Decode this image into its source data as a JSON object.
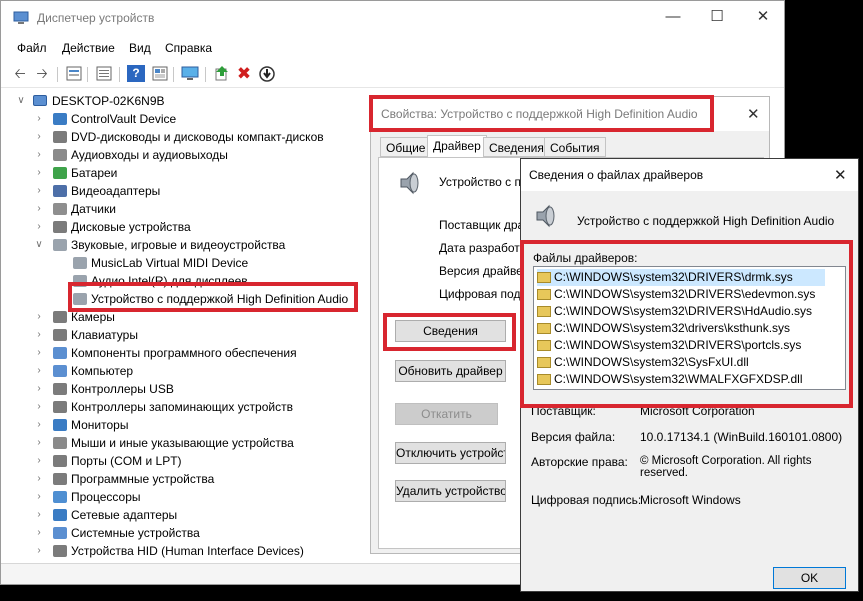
{
  "main_window": {
    "title": "Диспетчер устройств",
    "menu": [
      "Файл",
      "Действие",
      "Вид",
      "Справка"
    ],
    "tree": {
      "root": "DESKTOP-02K6N9B",
      "items": [
        {
          "label": "ControlVault Device",
          "level": 1,
          "expanded": false
        },
        {
          "label": "DVD-дисководы и дисководы компакт-дисков",
          "level": 1,
          "expanded": false
        },
        {
          "label": "Аудиовходы и аудиовыходы",
          "level": 1,
          "expanded": false
        },
        {
          "label": "Батареи",
          "level": 1,
          "expanded": false
        },
        {
          "label": "Видеоадаптеры",
          "level": 1,
          "expanded": false
        },
        {
          "label": "Датчики",
          "level": 1,
          "expanded": false
        },
        {
          "label": "Дисковые устройства",
          "level": 1,
          "expanded": false
        },
        {
          "label": "Звуковые, игровые и видеоустройства",
          "level": 1,
          "expanded": true
        },
        {
          "label": "MusicLab Virtual MIDI Device",
          "level": 2
        },
        {
          "label": "Аудио Intel(R) для дисплеев",
          "level": 2
        },
        {
          "label": "Устройство с поддержкой High Definition Audio",
          "level": 2,
          "highlighted": true
        },
        {
          "label": "Камеры",
          "level": 1,
          "expanded": false
        },
        {
          "label": "Клавиатуры",
          "level": 1,
          "expanded": false
        },
        {
          "label": "Компоненты программного обеспечения",
          "level": 1,
          "expanded": false
        },
        {
          "label": "Компьютер",
          "level": 1,
          "expanded": false
        },
        {
          "label": "Контроллеры USB",
          "level": 1,
          "expanded": false
        },
        {
          "label": "Контроллеры запоминающих устройств",
          "level": 1,
          "expanded": false
        },
        {
          "label": "Мониторы",
          "level": 1,
          "expanded": false
        },
        {
          "label": "Мыши и иные указывающие устройства",
          "level": 1,
          "expanded": false
        },
        {
          "label": "Порты (COM и LPT)",
          "level": 1,
          "expanded": false
        },
        {
          "label": "Программные устройства",
          "level": 1,
          "expanded": false
        },
        {
          "label": "Процессоры",
          "level": 1,
          "expanded": false
        },
        {
          "label": "Сетевые адаптеры",
          "level": 1,
          "expanded": false
        },
        {
          "label": "Системные устройства",
          "level": 1,
          "expanded": false
        },
        {
          "label": "Устройства HID (Human Interface Devices)",
          "level": 1,
          "expanded": false
        }
      ]
    }
  },
  "properties_dialog": {
    "title": "Свойства: Устройство с поддержкой High Definition Audio",
    "tabs": [
      "Общие",
      "Драйвер",
      "Сведения",
      "События"
    ],
    "active_tab": "Драйвер",
    "device_name": "Устройство с п",
    "fields": [
      "Поставщик драйв",
      "Дата разработк",
      "Версия драйвер",
      "Цифровая подпи"
    ],
    "buttons": {
      "details": "Сведения",
      "update": "Обновить драйвер",
      "rollback": "Откатить",
      "disable": "Отключить устройство",
      "uninstall": "Удалить устройство"
    }
  },
  "files_dialog": {
    "title": "Сведения о файлах драйверов",
    "device_name": "Устройство с поддержкой High Definition Audio",
    "files_label": "Файлы драйверов:",
    "files": [
      "C:\\WINDOWS\\system32\\DRIVERS\\drmk.sys",
      "C:\\WINDOWS\\system32\\DRIVERS\\edevmon.sys",
      "C:\\WINDOWS\\system32\\DRIVERS\\HdAudio.sys",
      "C:\\WINDOWS\\system32\\drivers\\ksthunk.sys",
      "C:\\WINDOWS\\system32\\DRIVERS\\portcls.sys",
      "C:\\WINDOWS\\system32\\SysFxUI.dll",
      "C:\\WINDOWS\\system32\\WMALFXGFXDSP.dll"
    ],
    "info": {
      "provider_label": "Поставщик:",
      "provider_value": "Microsoft Corporation",
      "version_label": "Версия файла:",
      "version_value": "10.0.17134.1 (WinBuild.160101.0800)",
      "copyright_label": "Авторские права:",
      "copyright_value": "© Microsoft Corporation. All rights reserved.",
      "signature_label": "Цифровая подпись:",
      "signature_value": "Microsoft Windows"
    },
    "ok_label": "OK"
  },
  "icons": [
    "back-icon",
    "forward-icon",
    "properties-icon",
    "show-hidden-icon",
    "help-icon",
    "view-icon",
    "monitor-icon",
    "update-driver-icon",
    "remove-icon",
    "download-icon",
    "computer-icon",
    "speaker-icon",
    "file-icon",
    "close-icon",
    "minimize-icon",
    "maximize-icon"
  ],
  "colors": {
    "highlight": "#d8262f",
    "selection": "#cce8ff",
    "title_text": "#7a7a7a"
  }
}
